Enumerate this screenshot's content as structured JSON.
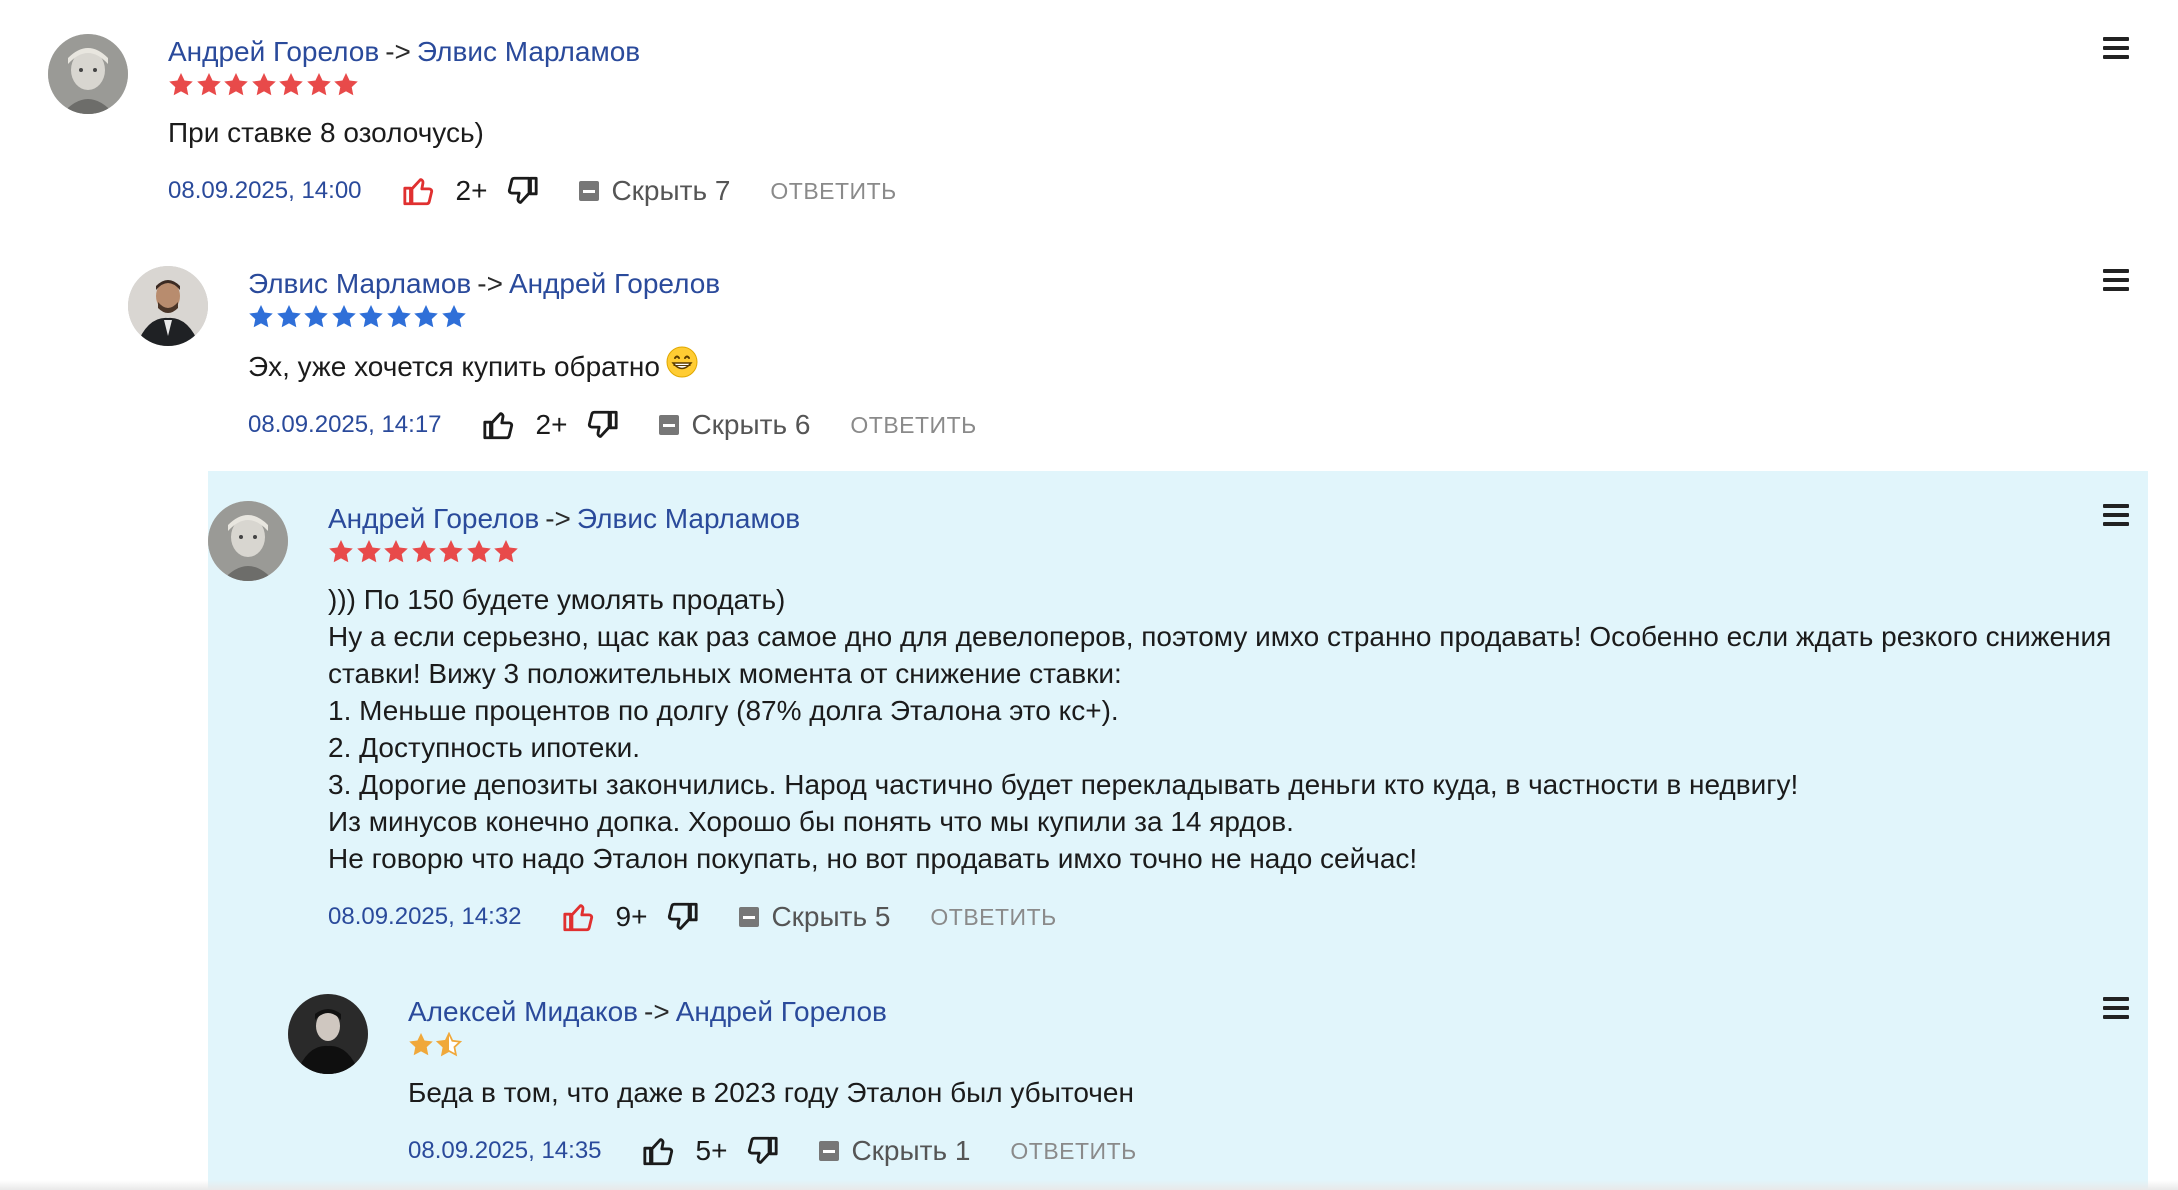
{
  "comments": [
    {
      "author": "Андрей Горелов",
      "arrow": "->",
      "recipient": "Элвис Марламов",
      "star_color": "#e84a4a",
      "stars": 7,
      "text": "При ставке 8 озолочусь)",
      "date": "08.09.2025, 14:00",
      "like_active": true,
      "score": "2+",
      "hide_label": "Скрыть 7",
      "reply_label": "ОТВЕТИТЬ"
    },
    {
      "author": "Элвис Марламов",
      "arrow": "->",
      "recipient": "Андрей Горелов",
      "star_color": "#2f6fd8",
      "stars": 8,
      "text": "Эх, уже хочется купить обратно",
      "emoji": "grinning-face-emoji",
      "date": "08.09.2025, 14:17",
      "like_active": false,
      "score": "2+",
      "hide_label": "Скрыть 6",
      "reply_label": "ОТВЕТИТЬ"
    },
    {
      "author": "Андрей Горелов",
      "arrow": "->",
      "recipient": "Элвис Марламов",
      "star_color": "#e84a4a",
      "stars": 7,
      "text": "))) По 150 будете умолять продать)\nНу а если серьезно, щас как раз самое дно для девелоперов, поэтому имхо странно продавать! Особенно если ждать резкого снижения\nставки! Вижу 3 положительных момента от снижение ставки:\n1. Меньше процентов по долгу (87% долга Эталона это кс+).\n2. Доступность ипотеки.\n3. Дорогие депозиты закончились. Народ частично будет перекладывать деньги кто куда, в частности в недвигу!\nИз минусов конечно допка. Хорошо бы понять что мы купили за 14 ярдов.\nНе говорю что надо Эталон покупать, но вот продавать имхо точно не надо сейчас!",
      "date": "08.09.2025, 14:32",
      "like_active": true,
      "score": "9+",
      "hide_label": "Скрыть 5",
      "reply_label": "ОТВЕТИТЬ"
    },
    {
      "author": "Алексей Мидаков",
      "arrow": "->",
      "recipient": "Андрей Горелов",
      "star_color": "#f0a83a",
      "stars": 1.5,
      "text": "Беда в том, что даже в 2023 году Эталон был убыточен",
      "date": "08.09.2025, 14:35",
      "like_active": false,
      "score": "5+",
      "hide_label": "Скрыть 1",
      "reply_label": "ОТВЕТИТЬ"
    }
  ],
  "colors": {
    "link": "#2a4a9b",
    "highlight_bg": "#e1f5fb",
    "like_active": "#e03030",
    "reply": "#8a8a8a"
  }
}
